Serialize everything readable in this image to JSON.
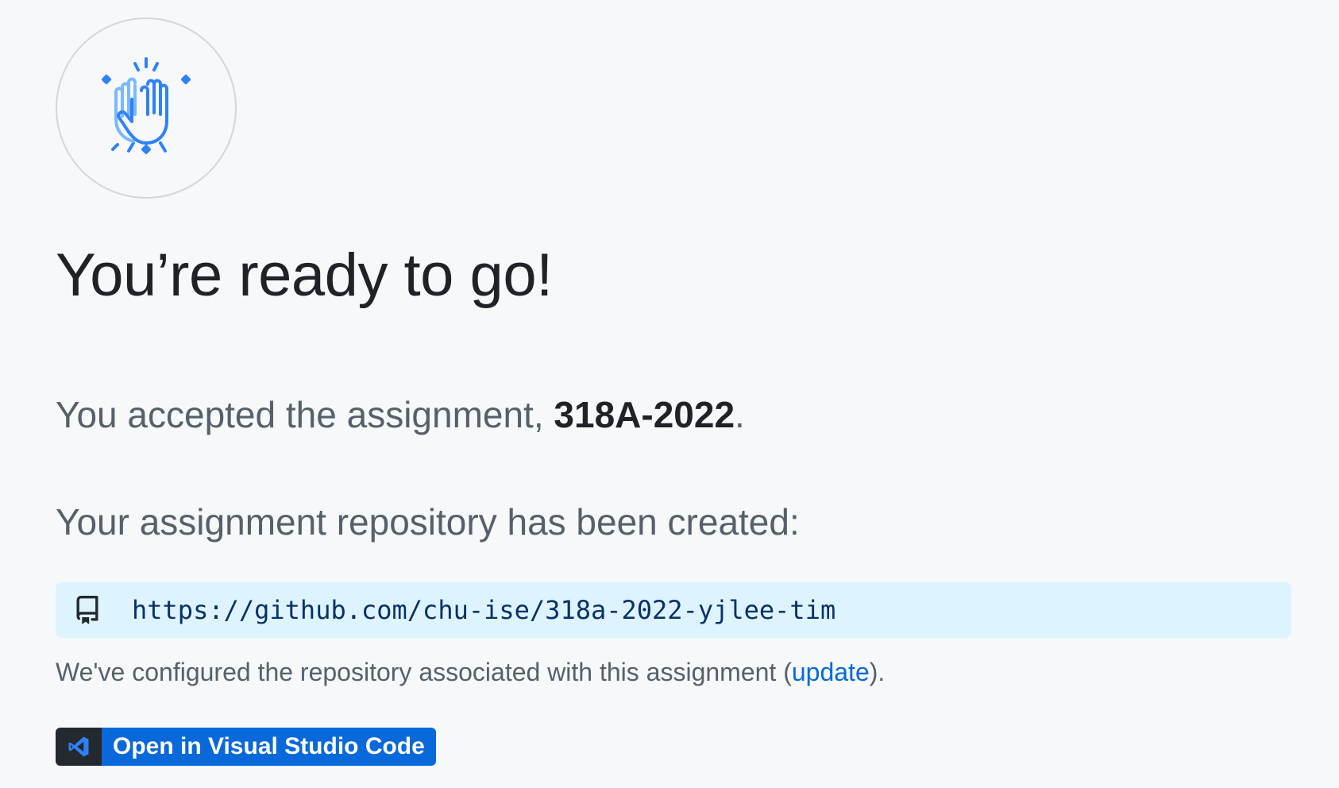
{
  "hero": {
    "icon": "high-five-icon",
    "accent_color": "#2f81f7"
  },
  "title": "You’re ready to go!",
  "accepted": {
    "prefix": "You accepted the assignment, ",
    "assignment_name": "318A-2022",
    "suffix": "."
  },
  "created_text": "Your assignment repository has been created:",
  "repo": {
    "icon": "repo-icon",
    "url": "https://github.com/chu-ise/318a-2022-yjlee-tim",
    "box_color": "#ddf4ff"
  },
  "configured": {
    "prefix": "We've configured the repository associated with this assignment (",
    "link_text": "update",
    "suffix": ")."
  },
  "open_button": {
    "icon": "vscode-icon",
    "label": "Open in Visual Studio Code",
    "color": "#0969da"
  }
}
